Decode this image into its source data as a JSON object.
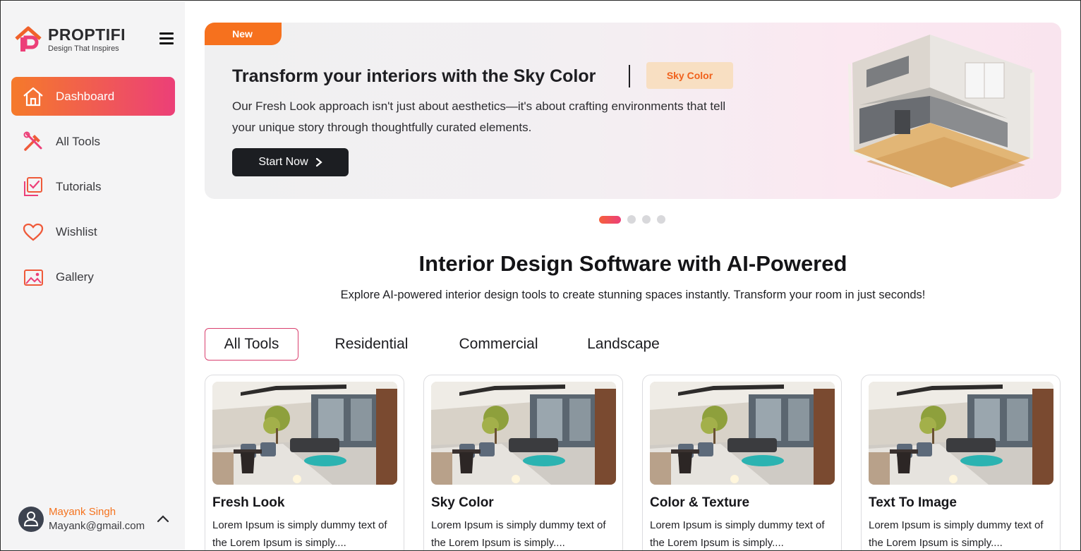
{
  "brand": {
    "name": "PROPTIFI",
    "tagline": "Design That Inspires",
    "accent": "#f4731f",
    "accent_pink": "#ec3f78"
  },
  "sidebar": {
    "menu_icon": "hamburger-icon",
    "items": [
      {
        "label": "Dashboard",
        "icon": "home-icon",
        "active": true
      },
      {
        "label": "All Tools",
        "icon": "tools-icon",
        "active": false
      },
      {
        "label": "Tutorials",
        "icon": "tutorials-icon",
        "active": false
      },
      {
        "label": "Wishlist",
        "icon": "heart-icon",
        "active": false
      },
      {
        "label": "Gallery",
        "icon": "gallery-icon",
        "active": false
      }
    ],
    "user": {
      "name": "Mayank Singh",
      "email": "Mayank@gmail.com",
      "icon": "user-icon",
      "toggle_icon": "chevron-up-icon"
    }
  },
  "banner": {
    "badge": "New",
    "title": "Transform your interiors with the Sky Color",
    "tag": "Sky Color",
    "description": "Our Fresh Look approach  isn't just about aesthetics—it's about crafting environments that tell your unique story through thoughtfully curated elements.",
    "cta": "Start Now",
    "cta_icon": "chevron-right-icon",
    "slides": 4,
    "active_slide": 1
  },
  "section": {
    "title": "Interior Design Software with AI-Powered",
    "subtitle": "Explore AI-powered interior design tools to create stunning spaces instantly. Transform your room in just seconds!"
  },
  "tabs": [
    {
      "label": "All Tools",
      "active": true
    },
    {
      "label": "Residential",
      "active": false
    },
    {
      "label": "Commercial",
      "active": false
    },
    {
      "label": "Landscape",
      "active": false
    }
  ],
  "cards": [
    {
      "title": "Fresh Look",
      "description": "Lorem Ipsum is simply dummy text of the Lorem Ipsum is simply...."
    },
    {
      "title": "Sky Color",
      "description": "Lorem Ipsum is simply dummy text of the Lorem Ipsum is simply...."
    },
    {
      "title": "Color & Texture",
      "description": "Lorem Ipsum is simply dummy text of the Lorem Ipsum is simply...."
    },
    {
      "title": "Text To Image",
      "description": "Lorem Ipsum is simply dummy text of the Lorem Ipsum is simply...."
    }
  ]
}
